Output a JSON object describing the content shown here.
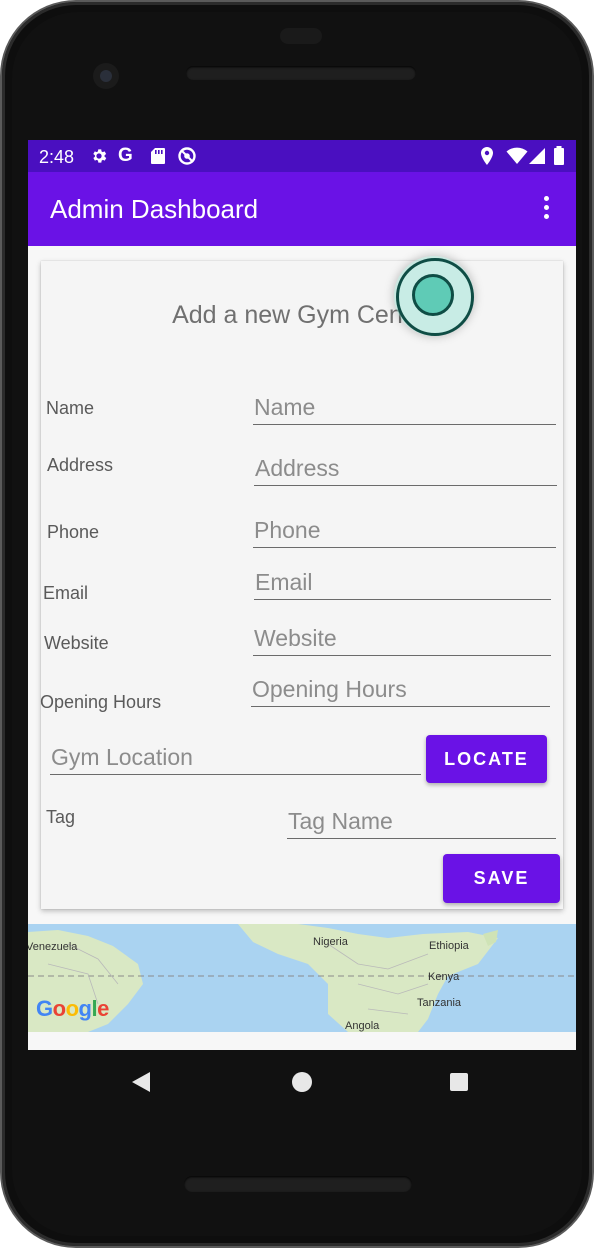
{
  "status_bar": {
    "time": "2:48",
    "icons": [
      "settings-icon",
      "google-g-icon",
      "sd-card-icon",
      "data-saver-icon",
      "location-icon",
      "wifi-icon",
      "signal-icon",
      "battery-icon"
    ],
    "google_g": "G"
  },
  "app_bar": {
    "title": "Admin Dashboard",
    "overflow_icon": "more-vert-icon"
  },
  "form": {
    "title": "Add a new Gym Centre",
    "name": {
      "label": "Name",
      "placeholder": "Name",
      "value": ""
    },
    "address": {
      "label": "Address",
      "placeholder": "Address",
      "value": ""
    },
    "phone": {
      "label": "Phone",
      "placeholder": "Phone",
      "value": ""
    },
    "email": {
      "label": "Email",
      "placeholder": "Email",
      "value": ""
    },
    "website": {
      "label": "Website",
      "placeholder": "Website",
      "value": ""
    },
    "opening_hours": {
      "label": "Opening Hours",
      "placeholder": "Opening Hours",
      "value": ""
    },
    "gym_location": {
      "placeholder": "Gym Location",
      "value": ""
    },
    "locate_button": "LOCATE",
    "tag": {
      "label": "Tag",
      "placeholder": "Tag Name",
      "value": ""
    },
    "save_button": "SAVE"
  },
  "map": {
    "labels": {
      "venezuela": "Venezuela",
      "nigeria": "Nigeria",
      "ethiopia": "Ethiopia",
      "kenya": "Kenya",
      "tanzania": "Tanzania",
      "angola": "Angola"
    },
    "logo_text": "Google",
    "water_color": "#aad3f1",
    "land_color": "#d9e8c4"
  },
  "nav_bar": {
    "back_icon": "back-icon",
    "home_icon": "home-icon",
    "recents_icon": "recents-icon"
  },
  "colors": {
    "primary": "#6a12e6",
    "status_bar": "#4a0fc0",
    "touch_indicator": "#5fcbb6"
  }
}
